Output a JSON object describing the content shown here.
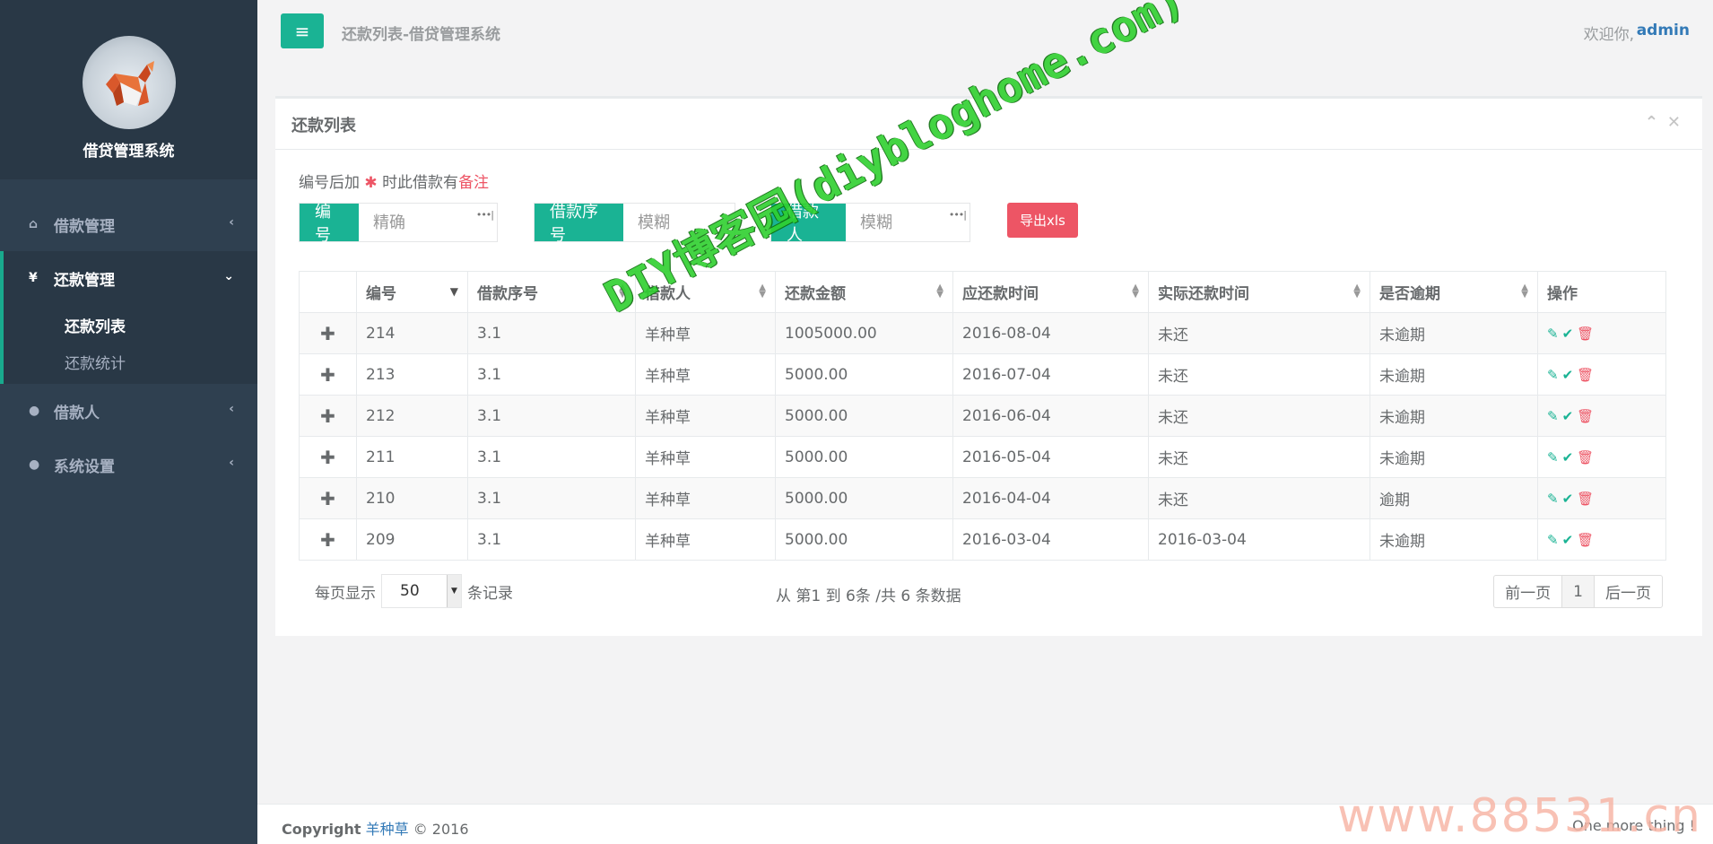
{
  "sidebar": {
    "app_name": "借贷管理系统",
    "menu": [
      {
        "label": "借款管理",
        "icon": "home-icon"
      },
      {
        "label": "还款管理",
        "icon": "yen-icon",
        "children": [
          "还款列表",
          "还款统计"
        ]
      },
      {
        "label": "借款人",
        "icon": "user-icon"
      },
      {
        "label": "系统设置",
        "icon": "user-icon"
      }
    ]
  },
  "topbar": {
    "breadcrumb": "还款列表-借贷管理系统",
    "welcome": "欢迎你,",
    "username": "admin"
  },
  "panel": {
    "title": "还款列表",
    "note_prefix": "编号后加",
    "note_star": "✱",
    "note_middle": "时此借款有",
    "note_highlight": "备注"
  },
  "filters": {
    "id_label": "编号",
    "id_placeholder": "精确",
    "loan_no_label": "借款序号",
    "loan_no_placeholder": "模糊",
    "borrower_label": "借款人",
    "borrower_placeholder": "模糊",
    "export_label": "导出xls"
  },
  "table": {
    "headers": [
      "编号",
      "借款序号",
      "借款人",
      "还款金额",
      "应还款时间",
      "实际还款时间",
      "是否逾期",
      "操作"
    ],
    "rows": [
      {
        "id": "214",
        "loan_no": "3.1",
        "borrower": "羊种草",
        "amount": "1005000.00",
        "due": "2016-08-04",
        "actual": "未还",
        "overdue": "未逾期"
      },
      {
        "id": "213",
        "loan_no": "3.1",
        "borrower": "羊种草",
        "amount": "5000.00",
        "due": "2016-07-04",
        "actual": "未还",
        "overdue": "未逾期"
      },
      {
        "id": "212",
        "loan_no": "3.1",
        "borrower": "羊种草",
        "amount": "5000.00",
        "due": "2016-06-04",
        "actual": "未还",
        "overdue": "未逾期"
      },
      {
        "id": "211",
        "loan_no": "3.1",
        "borrower": "羊种草",
        "amount": "5000.00",
        "due": "2016-05-04",
        "actual": "未还",
        "overdue": "未逾期"
      },
      {
        "id": "210",
        "loan_no": "3.1",
        "borrower": "羊种草",
        "amount": "5000.00",
        "due": "2016-04-04",
        "actual": "未还",
        "overdue": "逾期"
      },
      {
        "id": "209",
        "loan_no": "3.1",
        "borrower": "羊种草",
        "amount": "5000.00",
        "due": "2016-03-04",
        "actual": "2016-03-04",
        "overdue": "未逾期"
      }
    ]
  },
  "pager": {
    "per_page_prefix": "每页显示",
    "per_page_value": "50",
    "per_page_suffix": "条记录",
    "info": "从 第1 到 6条 /共 6 条数据",
    "prev": "前一页",
    "current": "1",
    "next": "后一页"
  },
  "footer": {
    "copyright": "Copyright",
    "author": "羊种草",
    "year": "© 2016",
    "right": "One more thing !"
  },
  "watermarks": {
    "diagonal": "DIY博客园(diybloghome.com)",
    "corner": "www.88531.cn"
  },
  "colors": {
    "sidebar": "#2f4050",
    "accent": "#1ab394",
    "danger": "#ed5565",
    "link": "#337ab7"
  }
}
